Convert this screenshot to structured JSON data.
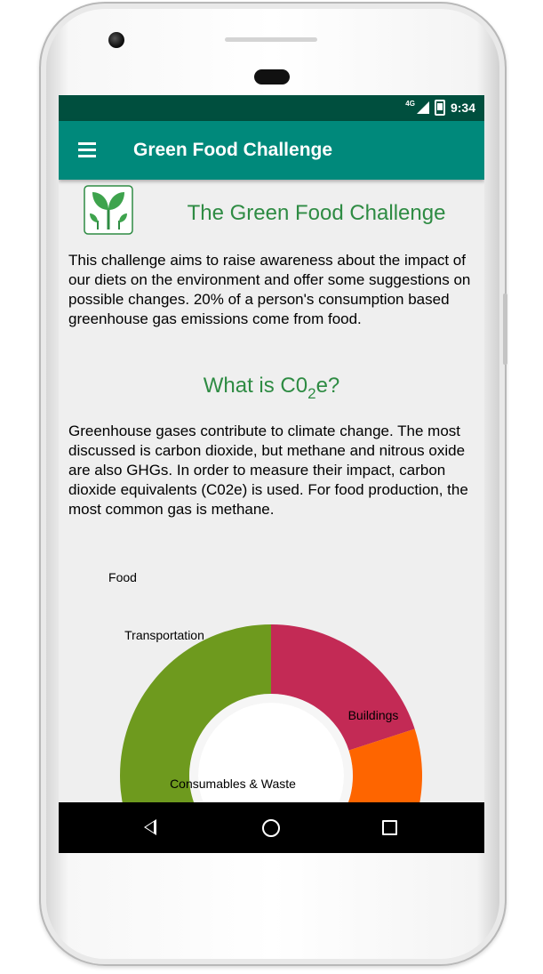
{
  "status_bar": {
    "network": "4G",
    "time": "9:34"
  },
  "toolbar": {
    "title": "Green Food Challenge",
    "menu_icon": "hamburger-menu-icon"
  },
  "content": {
    "heading": "The Green Food Challenge",
    "intro": "This challenge aims to raise awareness about the impact of our diets on the environment and offer some suggestions on possible changes. 20% of a person's consumption based greenhouse gas emissions come from food.",
    "co2_heading_prefix": "What is C0",
    "co2_heading_sub": "2",
    "co2_heading_suffix": "e?",
    "co2_text": "Greenhouse gases contribute to climate change. The most discussed is carbon dioxide, but methane and nitrous oxide are also GHGs. In order to measure their impact, carbon dioxide equivalents (C02e) is used. For food production, the most common gas is methane."
  },
  "chart_data": {
    "type": "pie",
    "labels": [
      "Food",
      "Buildings",
      "Consumables & Waste",
      "Transportation"
    ],
    "values": [
      20,
      24,
      14,
      42
    ],
    "colors": [
      "#c32a55",
      "#fe6500",
      "#f4c200",
      "#6e9a1e"
    ]
  },
  "nav": {
    "back_icon": "back-icon",
    "home_icon": "home-icon",
    "recents_icon": "recents-icon"
  },
  "colors": {
    "toolbar": "#00897b",
    "status_bar": "#004f3e",
    "heading": "#2e8b43"
  }
}
